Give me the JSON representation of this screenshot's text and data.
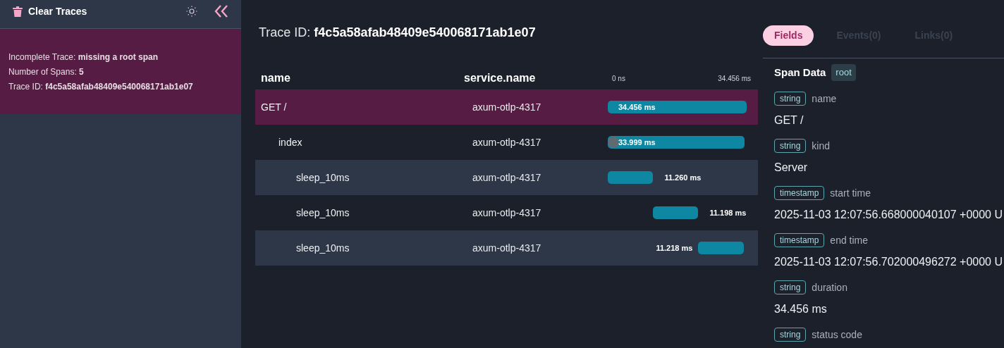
{
  "sidebar": {
    "clear_button": "Clear Traces",
    "traces": [
      {
        "selected": true,
        "lines": [
          "Incomplete Trace: **missing a root span**",
          "Number of Spans: **5**",
          "Trace ID: **f4c5a58afab48409e540068171ab1e07**"
        ]
      }
    ]
  },
  "trace": {
    "label": "Trace ID:",
    "id": "f4c5a58afab48409e540068171ab1e07"
  },
  "table": {
    "columns": [
      "name",
      "service.name"
    ],
    "axis": {
      "start": "0 ns",
      "end": "34.456 ms"
    },
    "rows": [
      {
        "name": "GET /",
        "service": "axum-otlp-4317",
        "duration": "34.456 ms",
        "selected": true,
        "marker": false,
        "kind": "inside",
        "children": [
          {
            "name": "index",
            "service": "axum-otlp-4317",
            "duration": "33.999 ms",
            "selected": false,
            "marker": true,
            "kind": "inside",
            "children": [
              {
                "name": "sleep_10ms",
                "service": "axum-otlp-4317",
                "duration": "11.260 ms",
                "selected": false,
                "marker": false,
                "kind": "right"
              },
              {
                "name": "sleep_10ms",
                "service": "axum-otlp-4317",
                "duration": "11.198 ms",
                "selected": false,
                "marker": false,
                "kind": "right"
              },
              {
                "name": "sleep_10ms",
                "service": "axum-otlp-4317",
                "duration": "11.218 ms",
                "selected": false,
                "marker": false,
                "kind": "left"
              }
            ]
          }
        ]
      }
    ]
  },
  "details": {
    "tabs": [
      {
        "label": "Fields",
        "selected": true
      },
      {
        "label": "Events(0)",
        "selected": false
      },
      {
        "label": "Links(0)",
        "selected": false
      }
    ],
    "title": "Span Data",
    "badge": "root",
    "fields": [
      {
        "type": "string",
        "name": "name",
        "value": "GET /"
      },
      {
        "type": "string",
        "name": "kind",
        "value": "Server"
      },
      {
        "type": "timestamp",
        "name": "start time",
        "value": "2025-11-03 12:07:56.668000040107 +0000 U"
      },
      {
        "type": "timestamp",
        "name": "end time",
        "value": "2025-11-03 12:07:56.702000496272 +0000 U"
      },
      {
        "type": "string",
        "name": "duration",
        "value": "34.456 ms"
      },
      {
        "type": "string",
        "name": "status code"
      }
    ]
  }
}
